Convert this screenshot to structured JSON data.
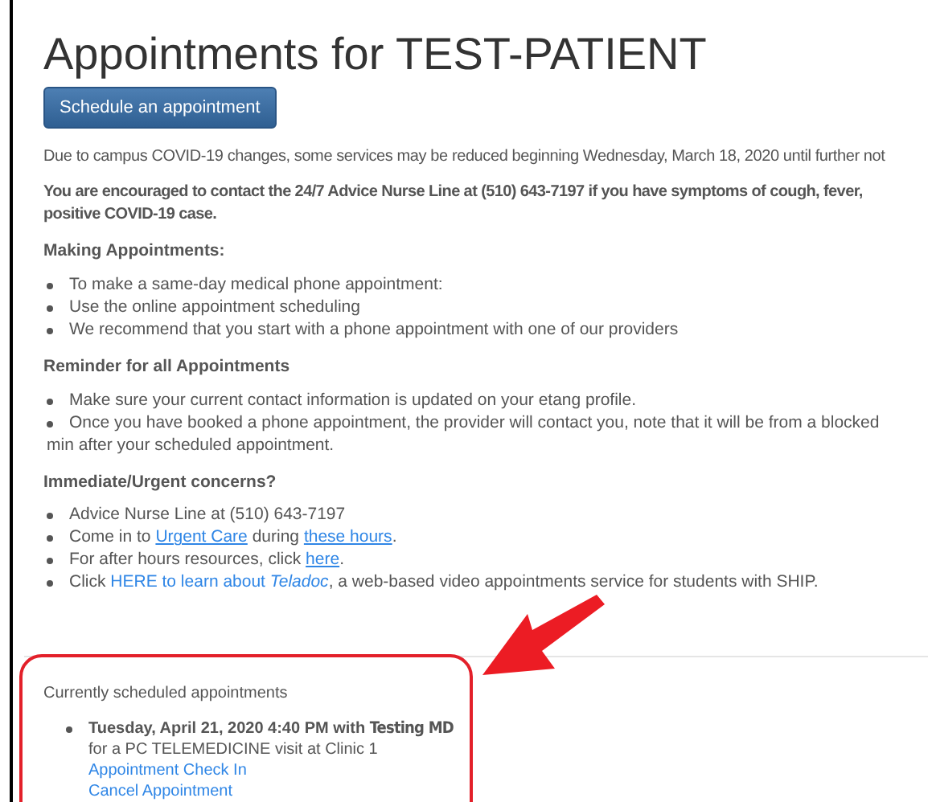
{
  "title": "Appointments for TEST-PATIENT",
  "schedule_button": "Schedule an appointment",
  "notice": "Due to campus COVID-19 changes, some services may be reduced beginning Wednesday, March 18, 2020 until further not",
  "advisory": [
    "You are encouraged to contact the 24/7 Advice Nurse Line at (510) 643-7197 if you have symptoms of cough, fever,",
    "positive COVID-19 case."
  ],
  "sections": [
    {
      "heading": "Making Appointments:",
      "kind": "list",
      "items": [
        {
          "lines": [
            [
              {
                "kind": "text",
                "text": "To make a same-day medical phone appointment:"
              }
            ]
          ]
        },
        {
          "lines": [
            [
              {
                "kind": "text",
                "text": "Use the online appointment scheduling"
              }
            ]
          ]
        },
        {
          "lines": [
            [
              {
                "kind": "text",
                "text": "We recommend that you start with a phone appointment with one of our providers"
              }
            ]
          ]
        }
      ]
    },
    {
      "heading": "Reminder for all Appointments",
      "kind": "hanging",
      "items": [
        {
          "lines": [
            [
              {
                "kind": "text",
                "text": "Make sure your current contact information is updated on your etang profile."
              }
            ]
          ]
        },
        {
          "lines": [
            [
              {
                "kind": "text",
                "text": "Once you have booked a phone appointment, the provider will contact you, note that it will be from a blocked"
              }
            ],
            [
              {
                "kind": "text",
                "text": "min after your scheduled appointment."
              }
            ]
          ]
        }
      ]
    },
    {
      "heading": "Immediate/Urgent concerns?",
      "kind": "list",
      "items": [
        {
          "lines": [
            [
              {
                "kind": "text",
                "text": "Advice Nurse Line at (510) 643-7197"
              }
            ]
          ]
        },
        {
          "lines": [
            [
              {
                "kind": "text",
                "text": "Come in to "
              },
              {
                "kind": "link",
                "text": "Urgent Care"
              },
              {
                "kind": "text",
                "text": " during "
              },
              {
                "kind": "link",
                "text": "these hours"
              },
              {
                "kind": "text",
                "text": "."
              }
            ]
          ]
        },
        {
          "lines": [
            [
              {
                "kind": "text",
                "text": "For after hours resources, click "
              },
              {
                "kind": "link",
                "text": "here"
              },
              {
                "kind": "text",
                "text": "."
              }
            ]
          ]
        },
        {
          "lines": [
            [
              {
                "kind": "text",
                "text": "Click "
              },
              {
                "kind": "plain-link",
                "text": "HERE to learn about *Teladoc*"
              },
              {
                "kind": "text",
                "text": ", a web-based video appointments service for students with SHIP."
              }
            ]
          ]
        }
      ]
    }
  ],
  "scheduled": {
    "heading": "Currently scheduled appointments",
    "appointments": [
      {
        "when": "Tuesday, April 21, 2020 4:40 PM with",
        "provider": "Testing MD",
        "detail": "for a PC TELEMEDICINE visit at Clinic 1",
        "links": [
          "Appointment Check In",
          "Cancel Appointment"
        ]
      }
    ]
  }
}
